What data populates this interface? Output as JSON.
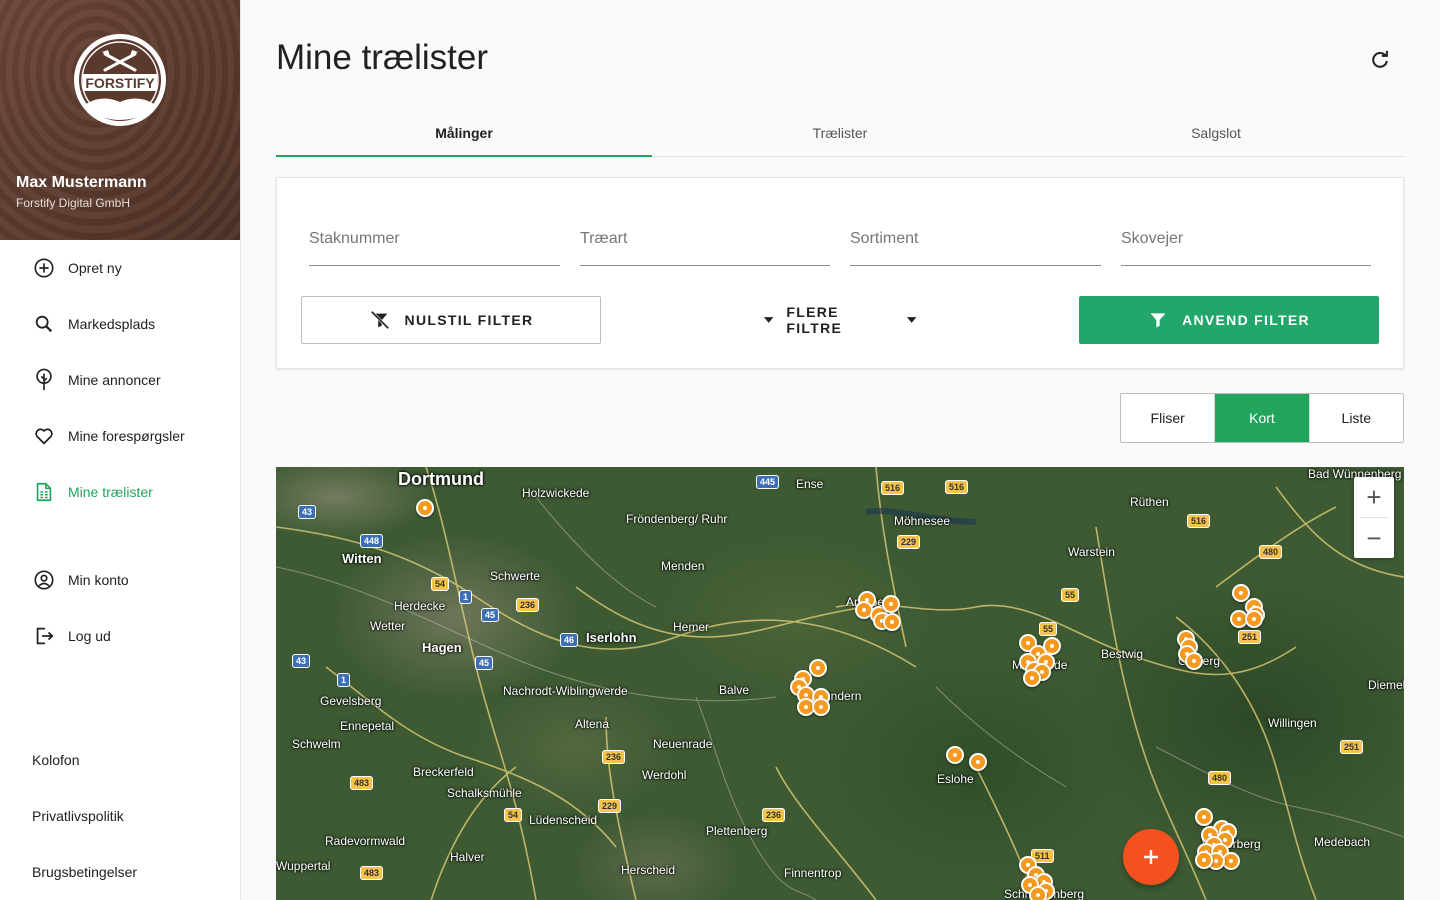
{
  "sidebar": {
    "user_name": "Max Mustermann",
    "company": "Forstify Digital GmbH",
    "logo_text": "FORSTIFY",
    "nav": [
      {
        "label": "Opret ny",
        "icon": "add-circle-icon"
      },
      {
        "label": "Markedsplads",
        "icon": "search-icon"
      },
      {
        "label": "Mine annoncer",
        "icon": "tree-icon"
      },
      {
        "label": "Mine forespørgsler",
        "icon": "heart-icon"
      },
      {
        "label": "Mine trælister",
        "icon": "document-list-icon",
        "active": true
      },
      {
        "label": "Min konto",
        "icon": "account-icon"
      },
      {
        "label": "Log ud",
        "icon": "logout-icon"
      }
    ],
    "footer": [
      "Kolofon",
      "Privatlivspolitik",
      "Brugsbetingelser"
    ]
  },
  "main": {
    "title": "Mine trælister",
    "tabs": [
      {
        "label": "Målinger",
        "active": true
      },
      {
        "label": "Trælister"
      },
      {
        "label": "Salgslot"
      }
    ],
    "filters": {
      "fields": [
        {
          "placeholder": "Staknummer"
        },
        {
          "placeholder": "Træart"
        },
        {
          "placeholder": "Sortiment"
        },
        {
          "placeholder": "Skovejer"
        }
      ],
      "reset_label": "NULSTIL FILTER",
      "more_label": "FLERE FILTRE",
      "apply_label": "ANVEND FILTER"
    },
    "view_toggle": [
      {
        "label": "Fliser"
      },
      {
        "label": "Kort",
        "active": true
      },
      {
        "label": "Liste"
      }
    ]
  },
  "map": {
    "places": [
      {
        "name": "Dortmund",
        "size": "big"
      },
      {
        "name": "Holzwickede"
      },
      {
        "name": "Witten",
        "size": "mid"
      },
      {
        "name": "Fröndenberg/ Ruhr"
      },
      {
        "name": "Ense"
      },
      {
        "name": "Möhnesee"
      },
      {
        "name": "Rüthen"
      },
      {
        "name": "Bad Wünnenberg"
      },
      {
        "name": "Warstein"
      },
      {
        "name": "Schwerte"
      },
      {
        "name": "Menden"
      },
      {
        "name": "Herdecke"
      },
      {
        "name": "Wetter"
      },
      {
        "name": "Hagen",
        "size": "mid"
      },
      {
        "name": "Iserlohn",
        "size": "mid"
      },
      {
        "name": "Hemer"
      },
      {
        "name": "Arnsberg"
      },
      {
        "name": "Bestwig"
      },
      {
        "name": "Olsberg"
      },
      {
        "name": "Diemelsee"
      },
      {
        "name": "Gevelsberg"
      },
      {
        "name": "Nachrodt-Wiblingwerde"
      },
      {
        "name": "Balve"
      },
      {
        "name": "Sundern"
      },
      {
        "name": "Meschede"
      },
      {
        "name": "Ennepetal"
      },
      {
        "name": "Altena"
      },
      {
        "name": "Schwelm"
      },
      {
        "name": "Neuenrade"
      },
      {
        "name": "Willingen"
      },
      {
        "name": "Breckerfeld"
      },
      {
        "name": "Werdohl"
      },
      {
        "name": "Eslohe"
      },
      {
        "name": "Schalksmühle"
      },
      {
        "name": "Lüdenscheid"
      },
      {
        "name": "Plettenberg"
      },
      {
        "name": "Radevormwald"
      },
      {
        "name": "Halver"
      },
      {
        "name": "Herscheid"
      },
      {
        "name": "Finnentrop"
      },
      {
        "name": "Medebach"
      },
      {
        "name": "Winterberg"
      },
      {
        "name": "Schmallenberg"
      },
      {
        "name": "Wuppertal"
      }
    ],
    "roads": [
      "43",
      "448",
      "54",
      "1",
      "45",
      "236",
      "46",
      "45",
      "43",
      "1",
      "483",
      "236",
      "229",
      "54",
      "236",
      "483",
      "445",
      "516",
      "516",
      "229",
      "516",
      "480",
      "55",
      "55",
      "251",
      "251",
      "480",
      "511"
    ],
    "marker_count": 62
  },
  "fab_icon": "plus-icon"
}
